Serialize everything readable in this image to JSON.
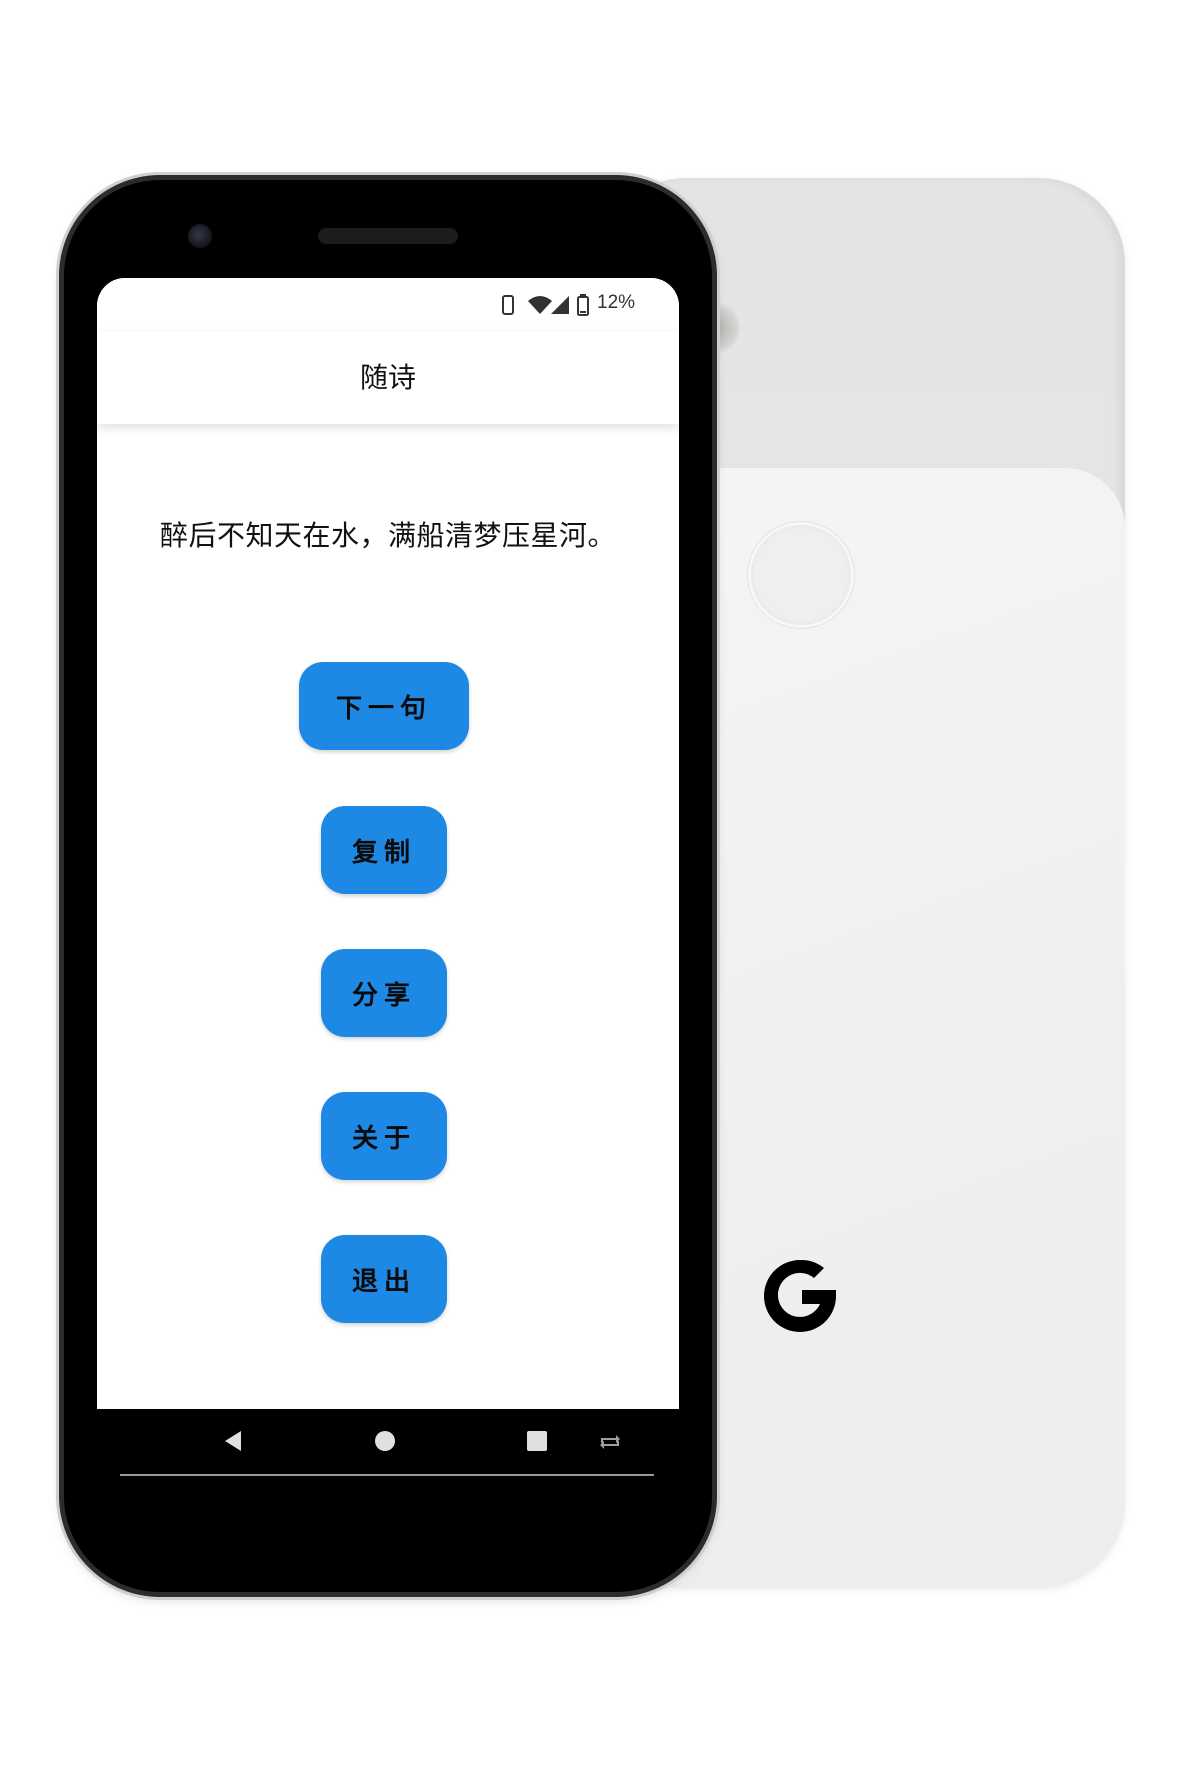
{
  "status_bar": {
    "battery_percent": "12%",
    "icons": [
      "phone-outline-icon",
      "wifi-icon",
      "cell-signal-icon",
      "battery-icon"
    ]
  },
  "app_bar": {
    "title": "随诗"
  },
  "poem": {
    "line": "醉后不知天在水，满船清梦压星河。"
  },
  "buttons": {
    "next": "下一句",
    "copy": "复制",
    "share": "分享",
    "about": "关于",
    "exit": "退出"
  },
  "nav_bar": {
    "icons": [
      "back-icon",
      "home-icon",
      "recents-icon",
      "rotate-icon"
    ]
  },
  "colors": {
    "button_blue": "#1e88e5",
    "screen_background": "#ffffff",
    "bezel": "#000000",
    "back_phone": "#e6e7e8",
    "power_accent": "#f08b38"
  }
}
